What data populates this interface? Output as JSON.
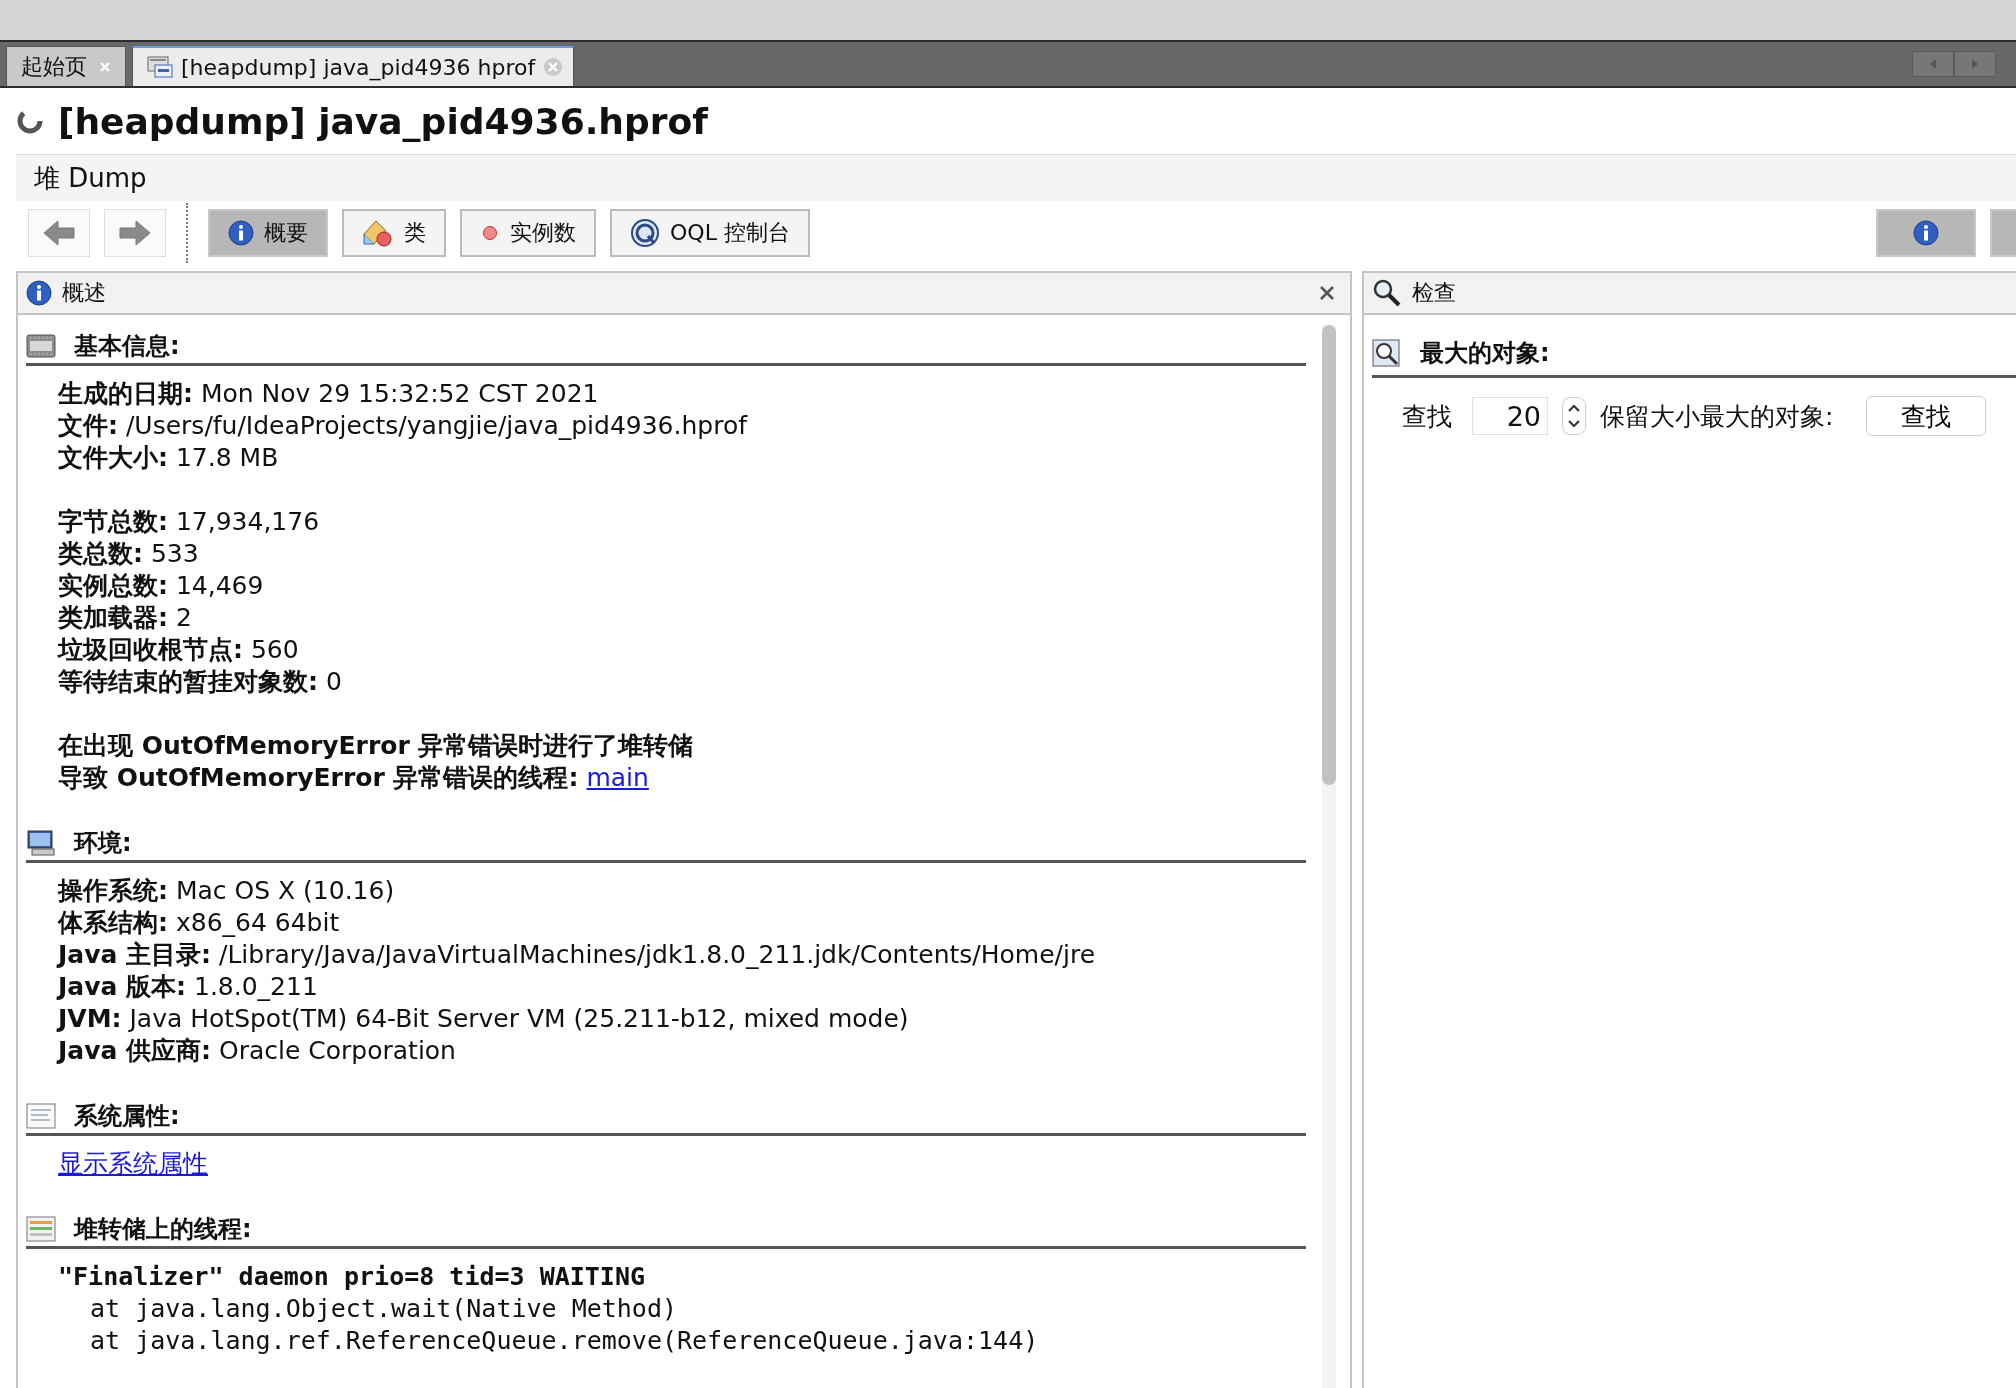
{
  "tabs": [
    {
      "label": "起始页",
      "selected": false
    },
    {
      "label": "[heapdump] java_pid4936 hprof",
      "selected": true
    }
  ],
  "title": "[heapdump] java_pid4936.hprof",
  "subtitle": "堆 Dump",
  "toolbar": [
    {
      "label": "概要",
      "kind": "info",
      "selected": true
    },
    {
      "label": "类",
      "kind": "classes",
      "selected": false
    },
    {
      "label": "实例数",
      "kind": "instances",
      "selected": false
    },
    {
      "label": "OQL 控制台",
      "kind": "oql",
      "selected": false
    }
  ],
  "left_panel": {
    "title": "概述",
    "sections": [
      {
        "title": "基本信息:",
        "groups": [
          [
            {
              "kind": "field",
              "label": "生成的日期:",
              "value": "Mon Nov 29 15:32:52 CST 2021"
            },
            {
              "kind": "field",
              "label": "文件:",
              "value": "/Users/fu/IdeaProjects/yangjie/java_pid4936.hprof"
            },
            {
              "kind": "field",
              "label": "文件大小:",
              "value": "17.8 MB"
            }
          ],
          [
            {
              "kind": "field",
              "label": "字节总数:",
              "value": "17,934,176"
            },
            {
              "kind": "field",
              "label": "类总数:",
              "value": "533"
            },
            {
              "kind": "field",
              "label": "实例总数:",
              "value": "14,469"
            },
            {
              "kind": "field",
              "label": "类加载器:",
              "value": "2"
            },
            {
              "kind": "field",
              "label": "垃圾回收根节点:",
              "value": "560"
            },
            {
              "kind": "field",
              "label": "等待结束的暂挂对象数:",
              "value": "0"
            }
          ],
          [
            {
              "kind": "bold",
              "label": "在出现 OutOfMemoryError 异常错误时进行了堆转储"
            },
            {
              "kind": "field_link",
              "label": "导致 OutOfMemoryError 异常错误的线程:",
              "value": "main"
            }
          ]
        ]
      },
      {
        "title": "环境:",
        "groups": [
          [
            {
              "kind": "field",
              "label": "操作系统:",
              "value": "Mac OS X (10.16)"
            },
            {
              "kind": "field",
              "label": "体系结构:",
              "value": "x86_64 64bit"
            },
            {
              "kind": "field",
              "label": "Java 主目录:",
              "value": "/Library/Java/JavaVirtualMachines/jdk1.8.0_211.jdk/Contents/Home/jre"
            },
            {
              "kind": "field",
              "label": "Java 版本:",
              "value": "1.8.0_211"
            },
            {
              "kind": "field",
              "label": "JVM:",
              "value": "Java HotSpot(TM) 64-Bit Server VM (25.211-b12, mixed mode)"
            },
            {
              "kind": "field",
              "label": "Java 供应商:",
              "value": "Oracle Corporation"
            }
          ]
        ]
      },
      {
        "title": "系统属性:",
        "groups": [
          [
            {
              "kind": "link",
              "value": "显示系统属性"
            }
          ]
        ]
      },
      {
        "title": "堆转储上的线程:",
        "groups": [
          [
            {
              "kind": "code_head",
              "value": "\"Finalizer\" daemon prio=8 tid=3 WAITING"
            },
            {
              "kind": "code",
              "value": "at java.lang.Object.wait(Native Method)"
            },
            {
              "kind": "code",
              "value": "at java.lang.ref.ReferenceQueue.remove(ReferenceQueue.java:144)"
            }
          ]
        ]
      }
    ]
  },
  "right_panel": {
    "title": "检查",
    "section_title": "最大的对象:",
    "find_label": "查找",
    "count": "20",
    "count_label": "保留大小最大的对象:",
    "find_button": "查找"
  }
}
